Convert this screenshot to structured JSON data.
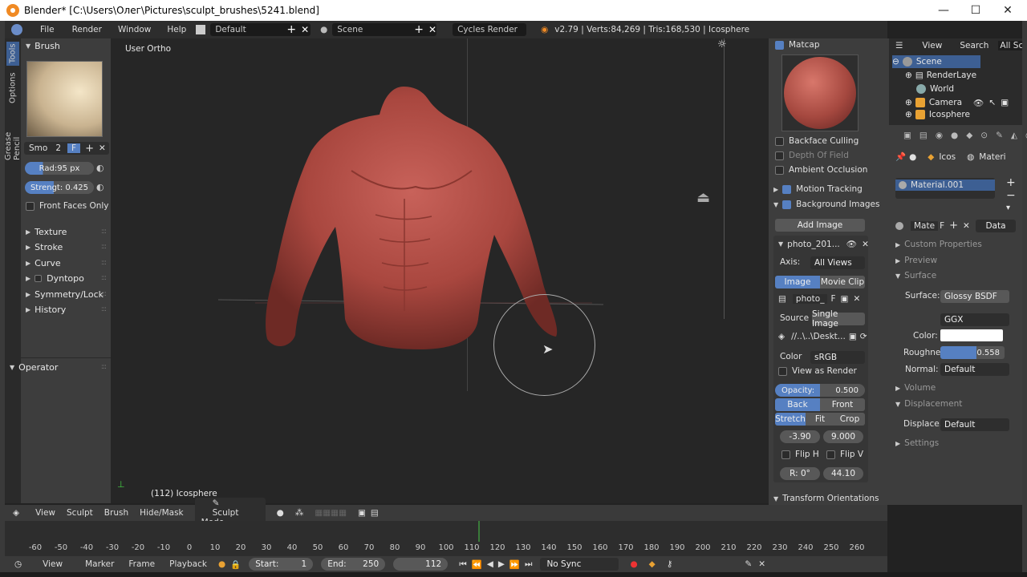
{
  "window": {
    "title": "Blender* [C:\\Users\\Олег\\Pictures\\sculpt_brushes\\5241.blend]",
    "min": "—",
    "max": "☐",
    "close": "✕"
  },
  "infobar": {
    "menus": [
      "File",
      "Render",
      "Window",
      "Help"
    ],
    "layout": "Default",
    "scene": "Scene",
    "engine": "Cycles Render",
    "stats": "v2.79 | Verts:84,269 | Tris:168,530 | Icosphere"
  },
  "toolshelf": {
    "tabs": [
      "Tools",
      "Options",
      "Grease Pencil"
    ],
    "brush_header": "Brush",
    "brush_name": "Smo",
    "brush_users": "2",
    "brush_f": "F",
    "radius": "Rad:95 px",
    "strength": "Strengt: 0.425",
    "front_faces": "Front Faces Only",
    "panels": [
      "Texture",
      "Stroke",
      "Curve",
      "Dyntopo",
      "Symmetry/Lock",
      "History"
    ],
    "operator": "Operator"
  },
  "viewport": {
    "view_label": "User Ortho",
    "object_label": "(112) Icosphere"
  },
  "props_left": {
    "matcap": "Matcap",
    "backface": "Backface Culling",
    "depth": "Depth Of Field",
    "ao": "Ambient Occlusion",
    "motion": "Motion Tracking",
    "bg_images": "Background Images",
    "add_image": "Add Image",
    "image_name": "photo_201...",
    "axis_label": "Axis:",
    "axis_value": "All Views",
    "tab_image": "Image",
    "tab_movie": "Movie Clip",
    "img_field": "photo_",
    "img_f": "F",
    "source_label": "Source",
    "source_value": "Single Image",
    "path": "//..\\..\\Deskt...",
    "color_label": "Color",
    "color_value": "sRGB",
    "view_as_render": "View as Render",
    "opacity": "Opacity:",
    "opacity_value": "0.500",
    "back": "Back",
    "front": "Front",
    "stretch": "Stretch",
    "fit": "Fit",
    "crop": "Crop",
    "offset_x": "-3.90",
    "offset_y": "9.000",
    "flip_h": "Flip H",
    "flip_v": "Flip V",
    "rotation": "R: 0°",
    "size": "44.10",
    "transform": "Transform Orientations"
  },
  "outliner": {
    "view": "View",
    "search": "Search",
    "all_scenes": "All Scene",
    "items": [
      "Scene",
      "RenderLaye",
      "World",
      "Camera",
      "Icosphere"
    ]
  },
  "props_right": {
    "crumb1": "Icos",
    "crumb2": "Materi",
    "material": "Material.001",
    "mate": "Mate",
    "mate_f": "F",
    "data": "Data",
    "sections": [
      "Custom Properties",
      "Preview"
    ],
    "surface": "Surface",
    "surface_label": "Surface:",
    "surface_value": "Glossy BSDF",
    "ggx": "GGX",
    "color_label": "Color:",
    "rough_label": "Roughne",
    "rough_value": "0.558",
    "normal_label": "Normal:",
    "normal_value": "Default",
    "volume": "Volume",
    "displacement": "Displacement",
    "disp_label": "Displace...",
    "disp_value": "Default",
    "settings": "Settings"
  },
  "header3d": {
    "items": [
      "View",
      "Sculpt",
      "Brush",
      "Hide/Mask"
    ],
    "mode": "Sculpt Mode"
  },
  "timeline": {
    "ticks": [
      "-60",
      "-50",
      "-40",
      "-30",
      "-20",
      "-10",
      "0",
      "10",
      "20",
      "30",
      "40",
      "50",
      "60",
      "70",
      "80",
      "90",
      "100",
      "110",
      "120",
      "130",
      "140",
      "150",
      "160",
      "170",
      "180",
      "190",
      "200",
      "210",
      "220",
      "230",
      "240",
      "250",
      "260"
    ],
    "current_frame": 112
  },
  "timeline_bar": {
    "menus": [
      "View",
      "Marker",
      "Frame",
      "Playback"
    ],
    "start_label": "Start:",
    "start": "1",
    "end_label": "End:",
    "end": "250",
    "frame": "112",
    "sync": "No Sync"
  },
  "colors": {
    "accent": "#5680c2",
    "skin": "#b5534a",
    "panel": "#3d3d3d"
  }
}
